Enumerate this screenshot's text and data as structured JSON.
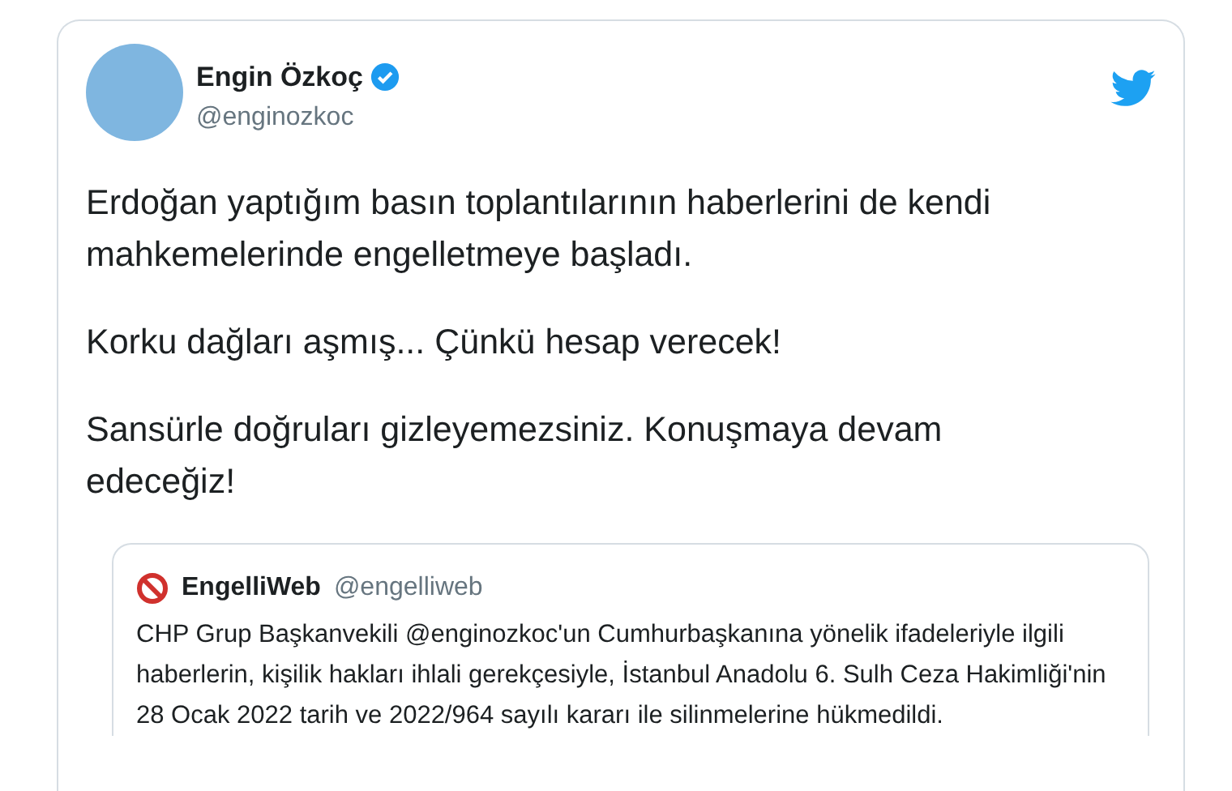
{
  "author": {
    "name": "Engin Özkoç",
    "verified": true,
    "handle": "@enginozkoc"
  },
  "paragraphs": [
    "Erdoğan yaptığım basın toplantılarının haberlerini de kendi mahkemelerinde engelletmeye başladı.",
    "Korku dağları aşmış... Çünkü hesap verecek!",
    "Sansürle doğruları gizleyemezsiniz. Konuşmaya devam edeceğiz!"
  ],
  "quoted_tweet": {
    "name": "EngelliWeb",
    "handle": "@engelliweb",
    "text": "CHP Grup Başkanvekili @enginozkoc'un Cumhurbaşkanına yönelik ifadeleriyle ilgili haberlerin, kişilik hakları ihlali gerekçesiyle, İstanbul Anadolu 6. Sulh Ceza Hakimliği'nin 28 Ocak 2022 tarih ve 2022/964 sayılı kararı ile silinmelerine hükmedildi."
  }
}
